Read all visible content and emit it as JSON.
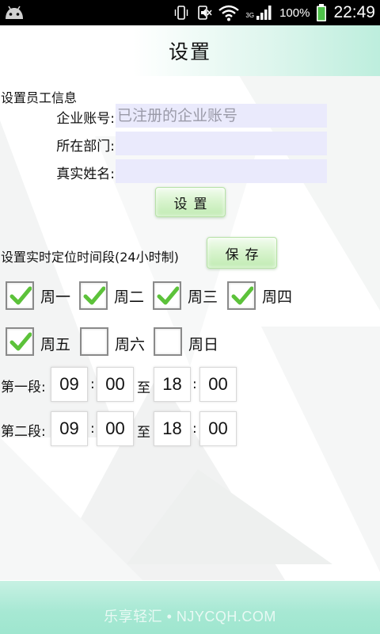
{
  "status_bar": {
    "network_type": "3G",
    "battery_percent": "100%",
    "time": "22:49"
  },
  "header": {
    "title": "设置"
  },
  "employee_info": {
    "section_label": "设置员工信息",
    "company_account": {
      "label": "企业账号:",
      "value": "",
      "placeholder": "已注册的企业账号"
    },
    "department": {
      "label": "所在部门:",
      "value": "",
      "placeholder": ""
    },
    "real_name": {
      "label": "真实姓名:",
      "value": "",
      "placeholder": ""
    },
    "set_button_label": "设置"
  },
  "location_schedule": {
    "section_label": "设置实时定位时间段(24小时制)",
    "save_button_label": "保存",
    "days": [
      {
        "label": "周一",
        "checked": true
      },
      {
        "label": "周二",
        "checked": true
      },
      {
        "label": "周三",
        "checked": true
      },
      {
        "label": "周四",
        "checked": true
      },
      {
        "label": "周五",
        "checked": true
      },
      {
        "label": "周六",
        "checked": false
      },
      {
        "label": "周日",
        "checked": false
      }
    ],
    "periods": [
      {
        "label": "第一段:",
        "start_hour": "09",
        "start_minute": "00",
        "to": "至",
        "end_hour": "18",
        "end_minute": "00"
      },
      {
        "label": "第二段:",
        "start_hour": "09",
        "start_minute": "00",
        "to": "至",
        "end_hour": "18",
        "end_minute": "00"
      }
    ],
    "colon": ":"
  },
  "footer": {
    "watermark": "乐享轻汇 • NJYCQH.COM"
  },
  "colors": {
    "accent_green": "#9fe6cf",
    "input_bg": "#eaeafc",
    "check_green": "#5cc23a"
  }
}
